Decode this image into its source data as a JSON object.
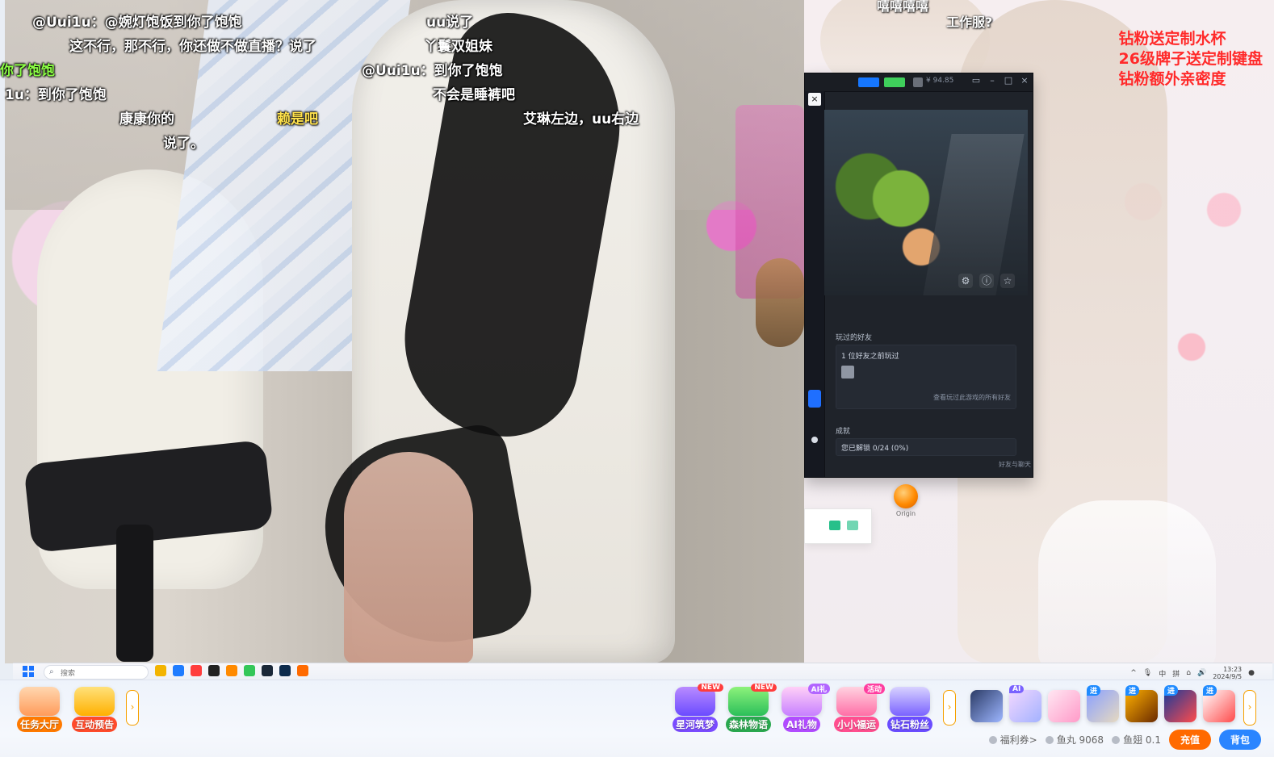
{
  "danmaku": [
    {
      "text": "@Uui1u：@婉灯饱饭到你了饱饱"
    },
    {
      "text": "uu说了"
    },
    {
      "text": "这不行，那不行，你还做不做直播？说了"
    },
    {
      "text": "丫鬟双姐妹"
    },
    {
      "text": "你了饱饱"
    },
    {
      "text": "@Uui1u：到你了饱饱"
    },
    {
      "text": "1u：到你了饱饱"
    },
    {
      "text": "不会是睡裤吧"
    },
    {
      "text": "康康你的"
    },
    {
      "text": "赖是吧"
    },
    {
      "text": "艾琳左边，uu右边"
    },
    {
      "text": "说了。"
    },
    {
      "text": "嘻嘻嘻嘻"
    },
    {
      "text": "工作服?"
    }
  ],
  "promo": {
    "lines": [
      "钻粉送定制水杯",
      "26级牌子送定制键盘",
      "钻粉额外亲密度"
    ]
  },
  "game_window": {
    "title_info": "¥ 94.85",
    "sections": {
      "friends_title": "玩过的好友",
      "friends_line": "1 位好友之前玩过",
      "friends_link": "查看玩过此游戏的所有好友",
      "achievements_title": "成就",
      "achievements_line": "您已解锁 0/24 (0%)",
      "footer": "好友与聊天"
    }
  },
  "desktop_icon": {
    "label": "Origin"
  },
  "windows_taskbar": {
    "search_placeholder": "搜索",
    "time": "13:23",
    "date": "2024/9/5",
    "ime_1": "中",
    "ime_2": "拼"
  },
  "bottom_bar": {
    "left_items": [
      {
        "label": "任务大厅"
      },
      {
        "label": "互动预告"
      }
    ],
    "center_items": [
      {
        "label": "星河筑梦",
        "tag": "NEW"
      },
      {
        "label": "森林物语",
        "tag": "NEW"
      },
      {
        "label": "AI礼物",
        "tag": "AI礼"
      },
      {
        "label": "小小福运",
        "tag": "活动"
      },
      {
        "label": "钻石粉丝",
        "tag": ""
      }
    ],
    "tiles_tags": [
      "AI",
      "",
      "进",
      "进",
      "进",
      "进"
    ],
    "wallet": {
      "voucher": "福利券>",
      "fish_ball": "鱼丸 9068",
      "fish_wing": "鱼翅 0.1",
      "charge_btn": "充值",
      "bag_btn": "背包"
    }
  },
  "colors": {
    "promo_red": "#ff2a2a",
    "charge_orange": "#ff6a00",
    "bag_blue": "#2a85ff"
  }
}
